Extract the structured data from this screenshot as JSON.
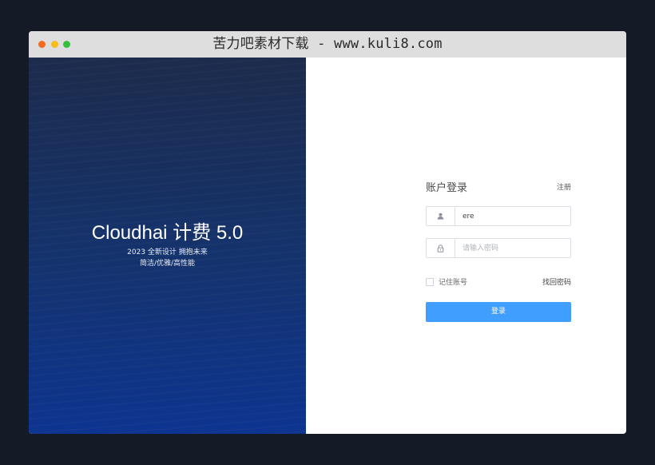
{
  "window": {
    "title": "苦力吧素材下载 - www.kuli8.com",
    "controls": [
      {
        "name": "close",
        "color": "#f26b22"
      },
      {
        "name": "minimize",
        "color": "#f5be1e"
      },
      {
        "name": "maximize",
        "color": "#34c03f"
      }
    ]
  },
  "hero": {
    "product_name": "Cloudhai 计费 5.0",
    "tagline_line1": "2023 全新设计 拥抱未来",
    "tagline_line2": "简洁/优雅/高性能"
  },
  "login": {
    "title": "账户登录",
    "register_label": "注册",
    "username": {
      "value": "ere",
      "icon": "user-icon"
    },
    "password": {
      "placeholder": "请输入密码",
      "icon": "lock-icon"
    },
    "remember_label": "记住账号",
    "remember_checked": false,
    "forgot_label": "找回密码",
    "submit_label": "登录"
  },
  "colors": {
    "accent": "#409eff",
    "titlebar": "#dedede",
    "hero_top": "#1d2b4c",
    "hero_bottom": "#0d3490",
    "backdrop": "#141a26"
  }
}
